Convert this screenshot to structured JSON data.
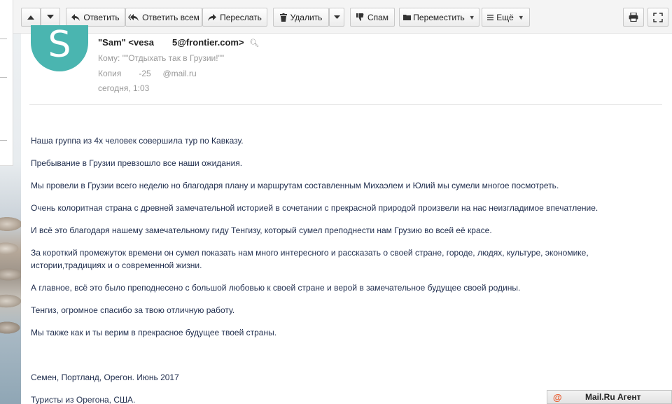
{
  "toolbar": {
    "reply_label": "Ответить",
    "reply_all_label": "Ответить всем",
    "forward_label": "Переслать",
    "delete_label": "Удалить",
    "spam_label": "Спам",
    "move_label": "Переместить",
    "more_label": "Ещё"
  },
  "message": {
    "avatar_letter": "S",
    "from_name": "\"Sam\"",
    "from_email": "<vesa          5@frontier.com>",
    "to": "Кому: \"\"Отдыхать так в Грузии!\"\"",
    "cc": "Копия          -25       @mail.ru",
    "date": "сегодня, 1:03",
    "paragraphs": [
      "Наша группа из 4х человек совершила тур по Кавказу.",
      "Пребывание  в Грузии превзошло все наши ожидания.",
      "Мы провели в Грузии всего неделю но благодаря плану и маршрутам составленным Михаэлем и Юлий мы сумели многое посмотреть.",
      "Очень колоритная страна с древней замечательной историей в сочетании с прекрасной природой произвели на нас неизгладимое впечатление.",
      "И всё это благодаря нашему замечательному гиду Тенгизу, который сумел преподнести нам Грузию во всей её красе.",
      "За короткий промежуток времени он сумел показать нам много интересного и рассказать о своей стране, городе, людях, культуре, экономике,",
      "истории,традициях и о современной жизни.",
      "А главное, всё это было преподнесено с большой любовью к своей стране и верой в замечательное будущее своей родины.",
      "Тенгиз, огромное спасибо за твою отличную работу.",
      "Мы также как и ты верим в прекрасное будущее твоей страны.",
      "Семен, Портланд, Орегон.  Июнь 2017",
      "Туристы из Орегона, США."
    ]
  },
  "agent": {
    "at_symbol": "@",
    "label": "Mail.Ru Агент"
  }
}
